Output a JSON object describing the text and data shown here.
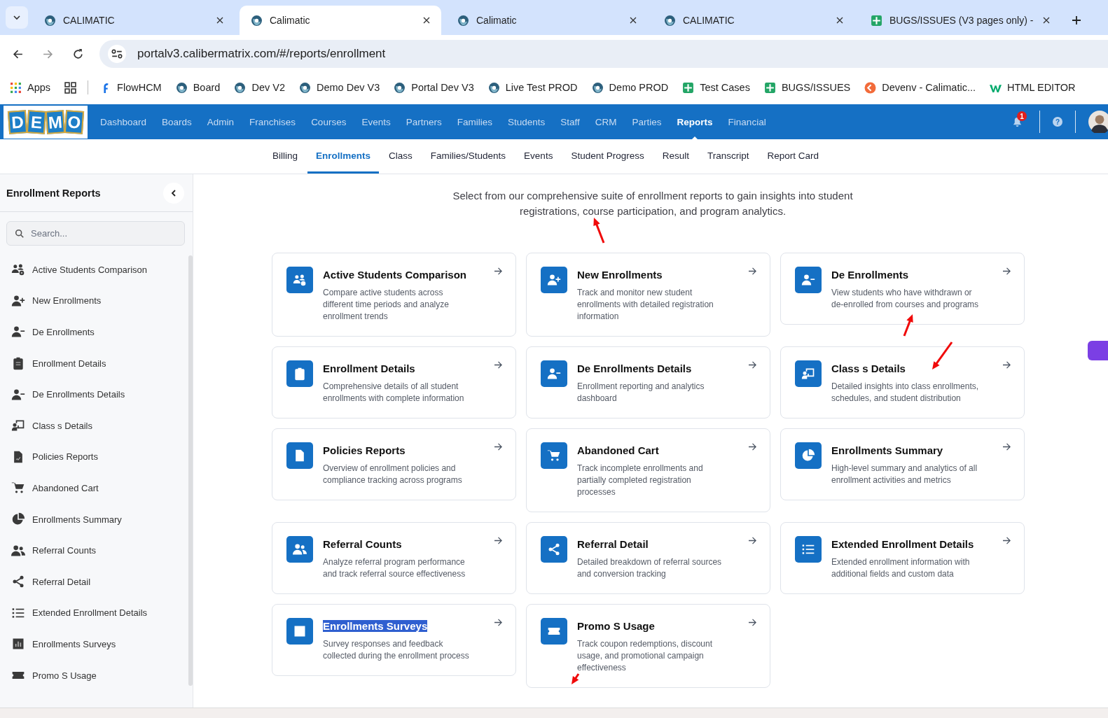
{
  "browser": {
    "tabs": [
      {
        "title": "CALIMATIC",
        "selected": false,
        "kind": "site"
      },
      {
        "title": "Calimatic",
        "selected": true,
        "kind": "site"
      },
      {
        "title": "Calimatic",
        "selected": false,
        "kind": "site"
      },
      {
        "title": "CALIMATIC",
        "selected": false,
        "kind": "site"
      },
      {
        "title": "BUGS/ISSUES (V3 pages only) -",
        "selected": false,
        "kind": "sheet"
      }
    ],
    "url": "portalv3.calibermatrix.com/#/reports/enrollment",
    "bookmarks": [
      {
        "label": "Apps",
        "kind": "apps"
      },
      {
        "label": "FlowHCM",
        "kind": "flow"
      },
      {
        "label": "Board",
        "kind": "globe"
      },
      {
        "label": "Dev V2",
        "kind": "globe"
      },
      {
        "label": "Demo Dev V3",
        "kind": "globe"
      },
      {
        "label": "Portal Dev V3",
        "kind": "globe"
      },
      {
        "label": "Live Test PROD",
        "kind": "globe"
      },
      {
        "label": "Demo PROD",
        "kind": "globe"
      },
      {
        "label": "Test Cases",
        "kind": "sheet"
      },
      {
        "label": "BUGS/ISSUES",
        "kind": "sheet"
      },
      {
        "label": "Devenv - Calimatic...",
        "kind": "devenv"
      },
      {
        "label": "HTML EDITOR",
        "kind": "w3"
      }
    ]
  },
  "app_nav": {
    "logo_letters": [
      "D",
      "E",
      "M",
      "O"
    ],
    "items": [
      {
        "label": "Dashboard",
        "selected": false
      },
      {
        "label": "Boards",
        "selected": false
      },
      {
        "label": "Admin",
        "selected": false
      },
      {
        "label": "Franchises",
        "selected": false
      },
      {
        "label": "Courses",
        "selected": false
      },
      {
        "label": "Events",
        "selected": false
      },
      {
        "label": "Partners",
        "selected": false
      },
      {
        "label": "Families",
        "selected": false
      },
      {
        "label": "Students",
        "selected": false
      },
      {
        "label": "Staff",
        "selected": false
      },
      {
        "label": "CRM",
        "selected": false
      },
      {
        "label": "Parties",
        "selected": false
      },
      {
        "label": "Reports",
        "selected": true
      },
      {
        "label": "Financial",
        "selected": false
      }
    ],
    "notification_count": "1",
    "help": "?"
  },
  "sub_tabs": [
    {
      "label": "Billing",
      "selected": false
    },
    {
      "label": "Enrollments",
      "selected": true
    },
    {
      "label": "Class",
      "selected": false
    },
    {
      "label": "Families/Students",
      "selected": false
    },
    {
      "label": "Events",
      "selected": false
    },
    {
      "label": "Student Progress",
      "selected": false
    },
    {
      "label": "Result",
      "selected": false
    },
    {
      "label": "Transcript",
      "selected": false
    },
    {
      "label": "Report Card",
      "selected": false
    }
  ],
  "sidebar": {
    "title": "Enrollment Reports",
    "search": {
      "placeholder": "Search..."
    },
    "items": [
      "Active Students Comparison",
      "New Enrollments",
      "De Enrollments",
      "Enrollment Details",
      "De Enrollments Details",
      "Class s Details",
      "Policies Reports",
      "Abandoned Cart",
      "Enrollments Summary",
      "Referral Counts",
      "Referral Detail",
      "Extended Enrollment Details",
      "Enrollments Surveys",
      "Promo S Usage"
    ]
  },
  "main": {
    "intro": "Select from our comprehensive suite of enrollment reports to gain insights into student registrations, course participation, and program analytics.",
    "cards": [
      {
        "title": "Active Students Comparison",
        "description": "Compare active students across different time periods and analyze enrollment trends",
        "highlighted": false
      },
      {
        "title": "New Enrollments",
        "description": "Track and monitor new student enrollments with detailed registration information",
        "highlighted": false
      },
      {
        "title": "De Enrollments",
        "description": "View students who have withdrawn or de-enrolled from courses and programs",
        "highlighted": false
      },
      {
        "title": "Enrollment Details",
        "description": "Comprehensive details of all student enrollments with complete information",
        "highlighted": false
      },
      {
        "title": "De Enrollments Details",
        "description": "Enrollment reporting and analytics dashboard",
        "highlighted": false
      },
      {
        "title": "Class s Details",
        "description": "Detailed insights into class enrollments, schedules, and student distribution",
        "highlighted": false
      },
      {
        "title": "Policies Reports",
        "description": "Overview of enrollment policies and compliance tracking across programs",
        "highlighted": false
      },
      {
        "title": "Abandoned Cart",
        "description": "Track incomplete enrollments and partially completed registration processes",
        "highlighted": false
      },
      {
        "title": "Enrollments Summary",
        "description": "High-level summary and analytics of all enrollment activities and metrics",
        "highlighted": false
      },
      {
        "title": "Referral Counts",
        "description": "Analyze referral program performance and track referral source effectiveness",
        "highlighted": false
      },
      {
        "title": "Referral Detail",
        "description": "Detailed breakdown of referral sources and conversion tracking",
        "highlighted": false
      },
      {
        "title": "Extended Enrollment Details",
        "description": "Extended enrollment information with additional fields and custom data",
        "highlighted": false
      },
      {
        "title": "Enrollments Surveys",
        "description": "Survey responses and feedback collected during the enrollment process",
        "highlighted": true
      },
      {
        "title": "Promo S Usage",
        "description": "Track coupon redemptions, discount usage, and promotional campaign effectiveness",
        "highlighted": false
      }
    ]
  }
}
